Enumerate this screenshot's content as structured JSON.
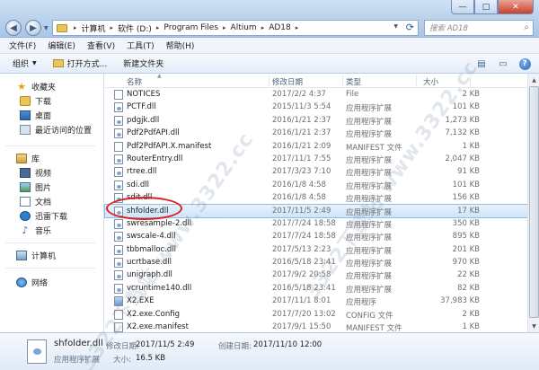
{
  "window": {
    "title": "AD18 AD18",
    "buttons": {
      "minimize": "—",
      "maximize": "□",
      "close": "✕"
    }
  },
  "address": {
    "crumbs": [
      "计算机",
      "软件 (D:)",
      "Program Files",
      "Altium",
      "AD18"
    ],
    "separator": "▸"
  },
  "search": {
    "placeholder": "搜索 AD18"
  },
  "menu": [
    "文件(F)",
    "编辑(E)",
    "查看(V)",
    "工具(T)",
    "帮助(H)"
  ],
  "toolbar": {
    "organize": "组织",
    "open_folder": "打开方式...",
    "new_folder": "新建文件夹"
  },
  "nav": {
    "favorites": "收藏夹",
    "favorites_items": [
      "下载",
      "桌面",
      "最近访问的位置"
    ],
    "libraries": "库",
    "library_items": [
      "视频",
      "图片",
      "文档",
      "迅雷下载",
      "音乐"
    ],
    "computer": "计算机",
    "network": "网络"
  },
  "columns": {
    "name": "名称",
    "date": "修改日期",
    "type": "类型",
    "size": "大小"
  },
  "files": [
    {
      "name": "NOTICES",
      "date": "2017/2/2 4:37",
      "type": "File",
      "size": "2 KB",
      "kind": "txt"
    },
    {
      "name": "PCTF.dll",
      "date": "2015/11/3 5:54",
      "type": "应用程序扩展",
      "size": "101 KB",
      "kind": "dll"
    },
    {
      "name": "pdgjk.dll",
      "date": "2016/1/21 2:37",
      "type": "应用程序扩展",
      "size": "1,273 KB",
      "kind": "dll"
    },
    {
      "name": "Pdf2PdfAPI.dll",
      "date": "2016/1/21 2:37",
      "type": "应用程序扩展",
      "size": "7,132 KB",
      "kind": "dll"
    },
    {
      "name": "Pdf2PdfAPI.X.manifest",
      "date": "2016/1/21 2:09",
      "type": "MANIFEST 文件",
      "size": "1 KB",
      "kind": "txt"
    },
    {
      "name": "RouterEntry.dll",
      "date": "2017/11/1 7:55",
      "type": "应用程序扩展",
      "size": "2,047 KB",
      "kind": "dll"
    },
    {
      "name": "rtree.dll",
      "date": "2017/3/23 7:10",
      "type": "应用程序扩展",
      "size": "91 KB",
      "kind": "dll"
    },
    {
      "name": "sdi.dll",
      "date": "2016/1/8 4:58",
      "type": "应用程序扩展",
      "size": "101 KB",
      "kind": "dll"
    },
    {
      "name": "sdit.dll",
      "date": "2016/1/8 4:58",
      "type": "应用程序扩展",
      "size": "156 KB",
      "kind": "dll"
    },
    {
      "name": "shfolder.dll",
      "date": "2017/11/5 2:49",
      "type": "应用程序扩展",
      "size": "17 KB",
      "kind": "dll",
      "selected": true
    },
    {
      "name": "swresample-2.dll",
      "date": "2017/7/24 18:58",
      "type": "应用程序扩展",
      "size": "350 KB",
      "kind": "dll"
    },
    {
      "name": "swscale-4.dll",
      "date": "2017/7/24 18:58",
      "type": "应用程序扩展",
      "size": "895 KB",
      "kind": "dll"
    },
    {
      "name": "tbbmalloc.dll",
      "date": "2017/5/13 2:23",
      "type": "应用程序扩展",
      "size": "201 KB",
      "kind": "dll"
    },
    {
      "name": "ucrtbase.dll",
      "date": "2016/5/18 23:41",
      "type": "应用程序扩展",
      "size": "970 KB",
      "kind": "dll"
    },
    {
      "name": "unigraph.dll",
      "date": "2017/9/2 20:58",
      "type": "应用程序扩展",
      "size": "22 KB",
      "kind": "dll"
    },
    {
      "name": "vcruntime140.dll",
      "date": "2016/5/18 23:41",
      "type": "应用程序扩展",
      "size": "82 KB",
      "kind": "dll"
    },
    {
      "name": "X2.EXE",
      "date": "2017/11/1 8:01",
      "type": "应用程序",
      "size": "37,983 KB",
      "kind": "exe"
    },
    {
      "name": "X2.exe.Config",
      "date": "2017/7/20 13:02",
      "type": "CONFIG 文件",
      "size": "2 KB",
      "kind": "txt"
    },
    {
      "name": "X2.exe.manifest",
      "date": "2017/9/1 15:50",
      "type": "MANIFEST 文件",
      "size": "1 KB",
      "kind": "txt"
    }
  ],
  "details": {
    "name": "shfolder.dll",
    "type": "应用程序扩展",
    "modified_label": "修改日期:",
    "modified": "2017/11/5 2:49",
    "created_label": "创建日期:",
    "created": "2017/11/10 12:00",
    "size_label": "大小:",
    "size": "16.5 KB"
  },
  "watermark": "3322下载站 www.3322.cc"
}
